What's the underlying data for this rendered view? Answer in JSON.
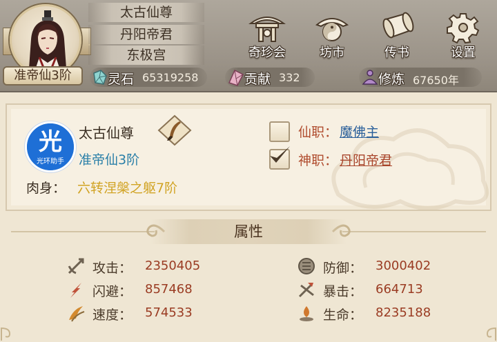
{
  "player": {
    "realm": "准帝仙3阶",
    "titles": [
      "太古仙尊",
      "丹阳帝君",
      "东极宫"
    ]
  },
  "nav": [
    {
      "label": "奇珍会",
      "icon": "pavilion-icon"
    },
    {
      "label": "坊市",
      "icon": "yin-yang-icon"
    },
    {
      "label": "传书",
      "icon": "scroll-icon"
    },
    {
      "label": "设置",
      "icon": "gear-icon"
    }
  ],
  "resources": [
    {
      "name": "灵石",
      "value": "65319258",
      "icon": "spirit-stone-icon"
    },
    {
      "name": "贡献",
      "value": "332",
      "icon": "contribution-icon"
    },
    {
      "name": "修炼",
      "value": "67650年",
      "icon": "cultivation-icon"
    }
  ],
  "info": {
    "name": "太古仙尊",
    "rank": "准帝仙3阶",
    "body_label": "肉身：",
    "body_value": "六转涅槃之躯7阶",
    "helper_logo_text": "光环助手",
    "helper_logo_glyph": "光",
    "immortal_post": {
      "label": "仙职：",
      "value": "魔佛主",
      "checked": false
    },
    "divine_post": {
      "label": "神职：",
      "value": "丹阳帝君",
      "checked": true
    }
  },
  "attributes": {
    "title": "属性",
    "items": [
      {
        "name": "攻击：",
        "value": "2350405",
        "icon": "attack-icon"
      },
      {
        "name": "防御：",
        "value": "3000402",
        "icon": "defense-icon"
      },
      {
        "name": "闪避：",
        "value": "857468",
        "icon": "dodge-icon"
      },
      {
        "name": "暴击：",
        "value": "664713",
        "icon": "critical-icon"
      },
      {
        "name": "速度：",
        "value": "574533",
        "icon": "speed-icon"
      },
      {
        "name": "生命：",
        "value": "8235188",
        "icon": "life-icon"
      }
    ]
  },
  "colors": {
    "rank_blue": "#2a7fa8",
    "body_gold": "#d1a323",
    "post_red": "#b04c2e",
    "immortal_post_value": "#2a5f9a",
    "divine_post_value": "#a8442a",
    "attr_value": "#9a3b22"
  }
}
